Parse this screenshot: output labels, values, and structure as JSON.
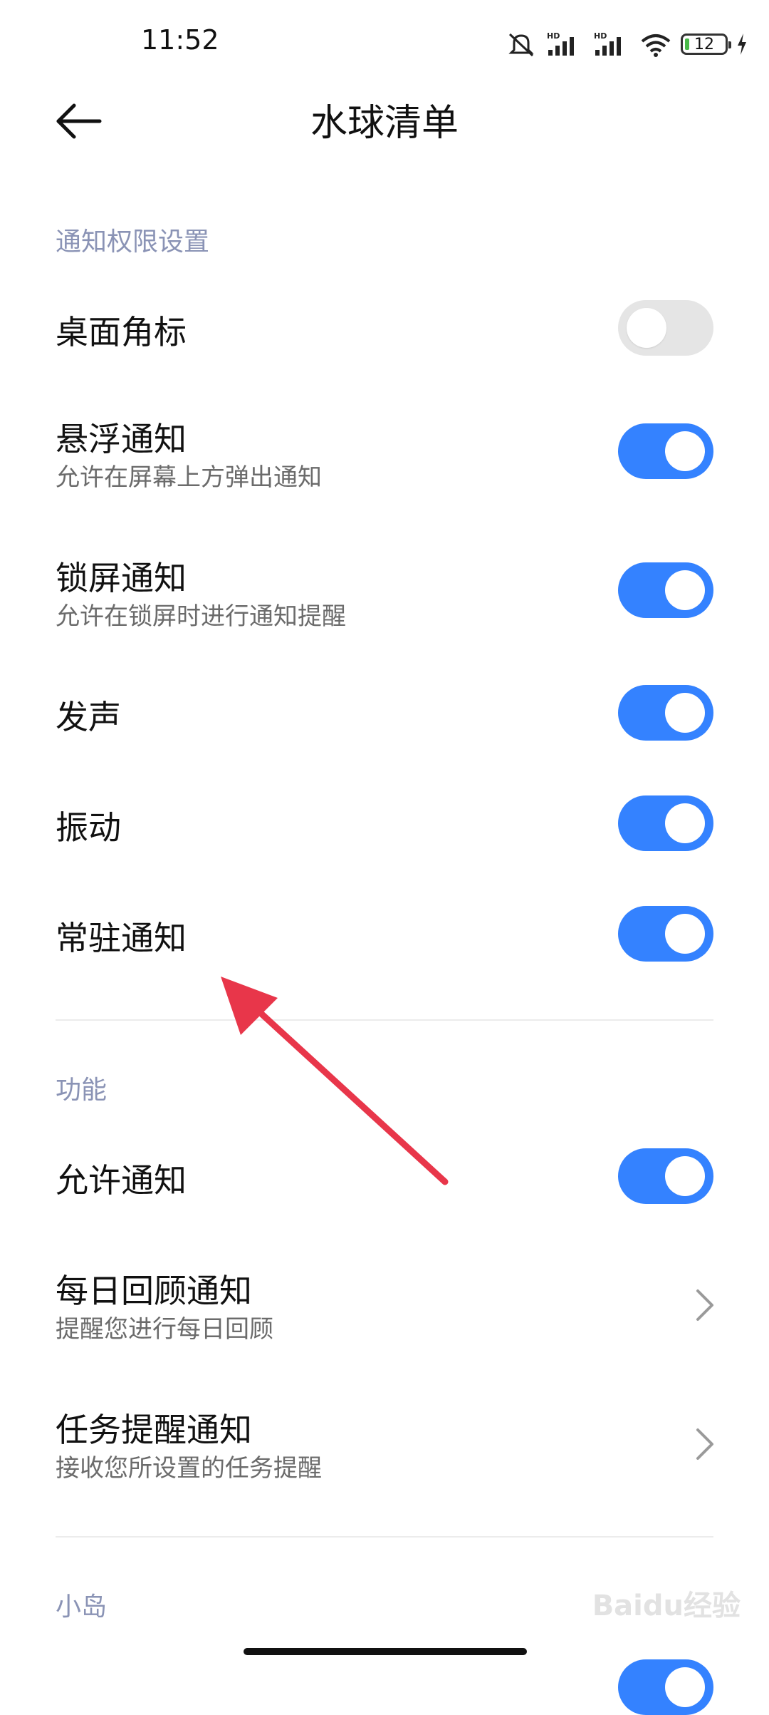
{
  "status_bar": {
    "time": "11:52",
    "battery": "12",
    "network_label_1": "HD",
    "network_label_2": "HD"
  },
  "header": {
    "title": "水球清单"
  },
  "sections": {
    "notification_permissions": {
      "title": "通知权限设置",
      "items": [
        {
          "title": "桌面角标",
          "enabled": false
        },
        {
          "title": "悬浮通知",
          "subtitle": "允许在屏幕上方弹出通知",
          "enabled": true
        },
        {
          "title": "锁屏通知",
          "subtitle": "允许在锁屏时进行通知提醒",
          "enabled": true
        },
        {
          "title": "发声",
          "enabled": true
        },
        {
          "title": "振动",
          "enabled": true
        },
        {
          "title": "常驻通知",
          "enabled": true
        }
      ]
    },
    "features": {
      "title": "功能",
      "items": [
        {
          "title": "允许通知",
          "enabled": true
        },
        {
          "title": "每日回顾通知",
          "subtitle": "提醒您进行每日回顾"
        },
        {
          "title": "任务提醒通知",
          "subtitle": "接收您所设置的任务提醒"
        }
      ]
    },
    "island": {
      "title": "小岛"
    }
  },
  "watermark": "Baidu经验",
  "colors": {
    "accent": "#3482ff",
    "toggle_off": "#e5e5e5",
    "section_title": "#8a93b5",
    "annotation_arrow": "#e8364a"
  }
}
